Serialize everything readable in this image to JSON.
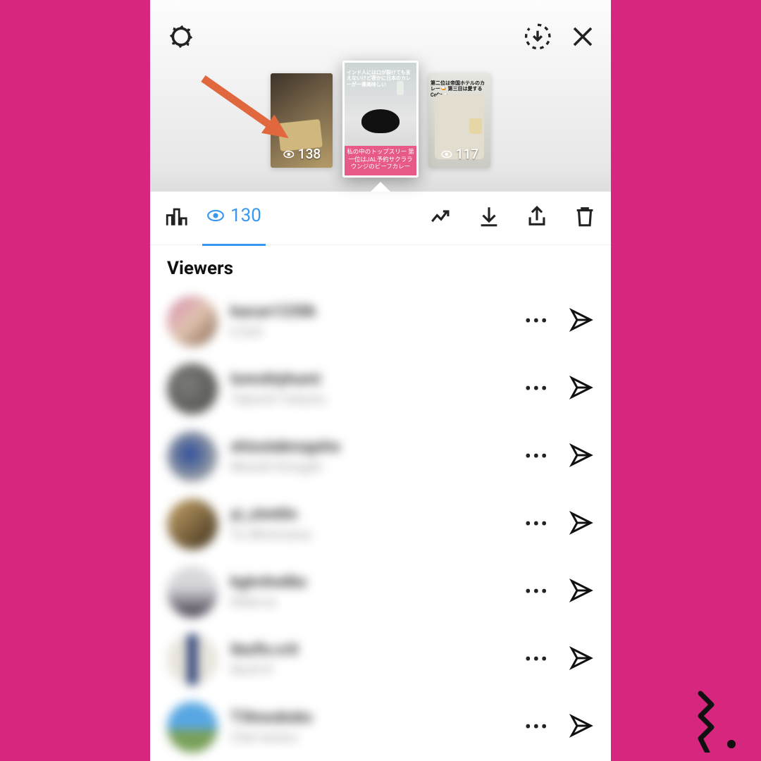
{
  "header": {
    "stories": [
      {
        "top_text": "",
        "views": "138"
      },
      {
        "top_text": "インド人には口が裂けても言えないけど密かに日本のカレーが一番美味しい",
        "views": "130",
        "caption": "私の中のトップスリー 第一位はJAL予約サクララウンジのビーフカレー"
      },
      {
        "top_text": "第二位は帝国ホテルのカレー🍛 第三目は愛するCoCo🍛",
        "views": "117"
      }
    ]
  },
  "toolbar": {
    "view_count": "130"
  },
  "viewers": {
    "title": "Viewers",
    "rows": [
      {
        "username": "kacun1230k",
        "name": "k.Euli"
      },
      {
        "username": "lomcktyhumi",
        "name": "Takechl Yobarts"
      },
      {
        "username": "shizutabnzgsho",
        "name": "Miwshl Kimgati"
      },
      {
        "username": "yi_clmt0n",
        "name": "Yu Minimawa"
      },
      {
        "username": "kgtn4velbs",
        "name": "KltbA.ki"
      },
      {
        "username": "Ilezfiv.crit",
        "name": "Nichl R"
      },
      {
        "username": "T3tnsobsks",
        "name": "Chel tenloo"
      }
    ]
  }
}
